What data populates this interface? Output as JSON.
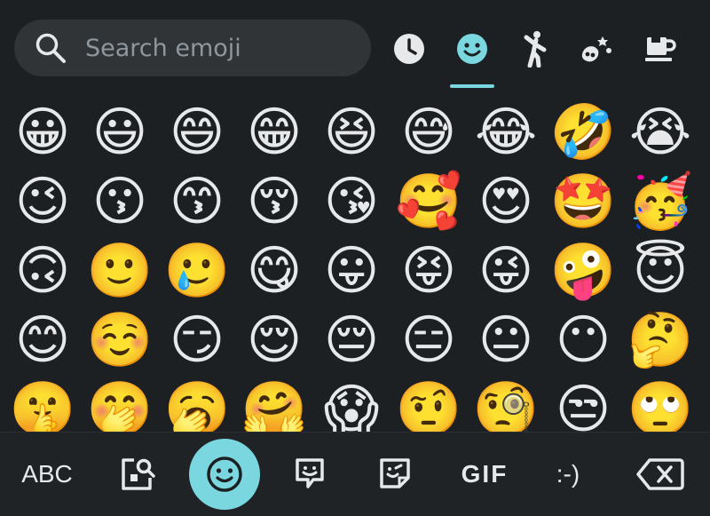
{
  "search": {
    "placeholder": "Search emoji"
  },
  "categories": [
    {
      "icon": "clock-icon",
      "label": "Recent"
    },
    {
      "icon": "smiley-icon",
      "label": "Smileys"
    },
    {
      "icon": "person-icon",
      "label": "People"
    },
    {
      "icon": "animals-icon",
      "label": "Animals & nature"
    },
    {
      "icon": "food-icon",
      "label": "Food & drink"
    }
  ],
  "emoji_rows": [
    [
      "😀",
      "😃",
      "😄",
      "😁",
      "😆",
      "😅",
      "😂",
      "🤣",
      "😭"
    ],
    [
      "😉",
      "😗",
      "😙",
      "😚",
      "😘",
      "🥰",
      "😍",
      "🤩",
      "🥳"
    ],
    [
      "🙃",
      "🙂",
      "🥲",
      "😋",
      "😛",
      "😝",
      "😜",
      "🤪",
      "😇"
    ],
    [
      "😊",
      "☺️",
      "😏",
      "😌",
      "😔",
      "😑",
      "😐",
      "😶",
      "🤔"
    ],
    [
      "🤫",
      "🤭",
      "🥱",
      "🤗",
      "😱",
      "🤨",
      "🧐",
      "😒",
      "🙄"
    ]
  ],
  "bottom_bar": {
    "abc_label": "ABC",
    "gif_label": "GIF",
    "emoticon_label": ":-)"
  },
  "colors": {
    "accent": "#7ad7e0",
    "background": "#1d2023",
    "search_bg": "#303437"
  }
}
